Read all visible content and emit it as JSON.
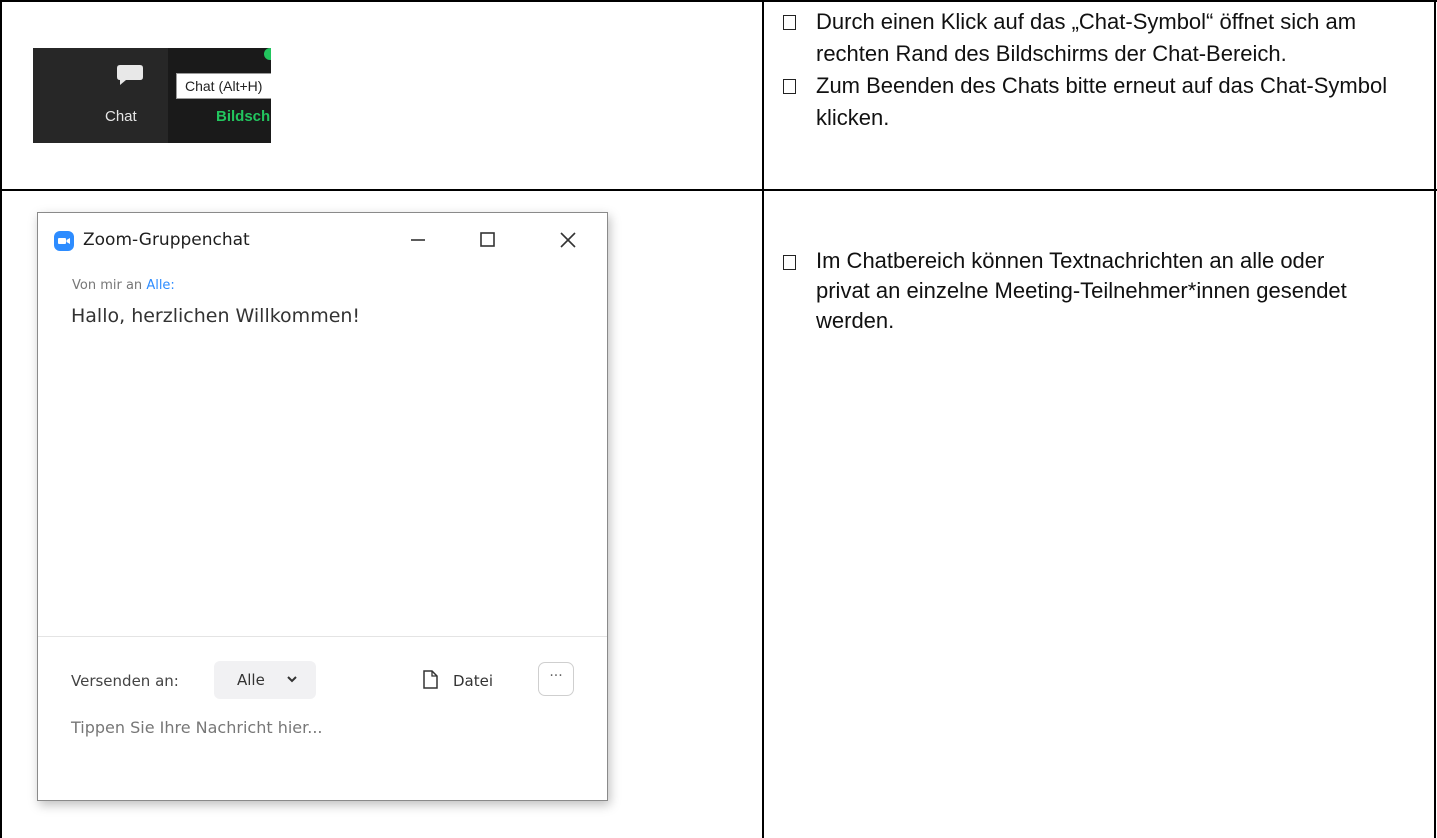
{
  "toolbar": {
    "chat_label": "Chat",
    "tooltip": "Chat (Alt+H)",
    "share_label": "Bildschirm"
  },
  "section1": {
    "bullets": [
      "Durch einen Klick auf das „Chat-Symbol“ öffnet sich am rechten Rand des Bildschirms der Chat-Bereich.",
      "Zum Beenden des Chats bitte erneut auf das Chat-Symbol klicken."
    ]
  },
  "chat_window": {
    "title": "Zoom-Gruppenchat",
    "from_prefix": "Von mir an ",
    "from_target": "Alle:",
    "message": "Hallo, herzlichen Willkommen!",
    "send_to_label": "Versenden an:",
    "recipient": "Alle",
    "file_label": "Datei",
    "more_label": "···",
    "input_placeholder": "Tippen Sie Ihre Nachricht hier..."
  },
  "section2": {
    "bullets": [
      "Im Chatbereich können Textnachrichten an alle oder privat an einzelne Meeting-Teilnehmer*innen gesendet werden."
    ]
  },
  "colors": {
    "zoom_blue": "#2d8cff",
    "share_green": "#22c55e",
    "toolbar_dark": "#1a1a1a"
  }
}
